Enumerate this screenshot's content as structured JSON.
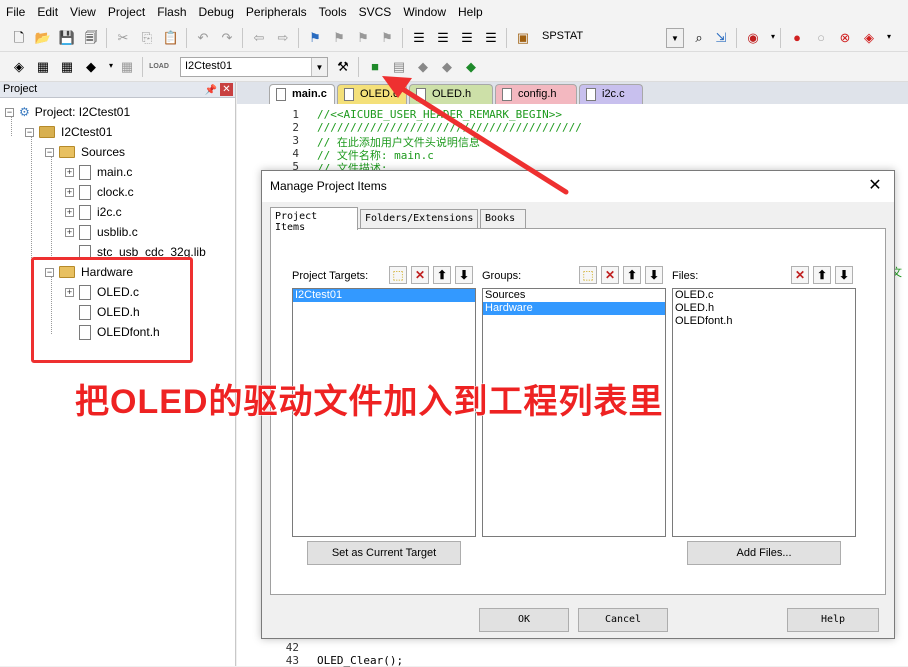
{
  "menu": [
    "File",
    "Edit",
    "View",
    "Project",
    "Flash",
    "Debug",
    "Peripherals",
    "Tools",
    "SVCS",
    "Window",
    "Help"
  ],
  "toolbar1": {
    "target_combo_value": "SPSTAT"
  },
  "toolbar2": {
    "load_label": "LOAD",
    "target_select_value": "I2Ctest01"
  },
  "project_panel": {
    "title": "Project",
    "tree": {
      "project": "Project: I2Ctest01",
      "target": "I2Ctest01",
      "groups": [
        {
          "name": "Sources",
          "files": [
            "main.c",
            "clock.c",
            "i2c.c",
            "usblib.c",
            "stc_usb_cdc_32g.lib"
          ]
        },
        {
          "name": "Hardware",
          "files": [
            "OLED.c",
            "OLED.h",
            "OLEDfont.h"
          ]
        }
      ]
    }
  },
  "editor": {
    "tabs": [
      "main.c",
      "OLED.c",
      "OLED.h",
      "config.h",
      "i2c.c"
    ],
    "lines": [
      {
        "n": "1",
        "text": "//<<AICUBE_USER_HEADER_REMARK_BEGIN>>"
      },
      {
        "n": "2",
        "text": "////////////////////////////////////////"
      },
      {
        "n": "3",
        "text": "// 在此添加用户文件头说明信息"
      },
      {
        "n": "4",
        "text": "// 文件名称: main.c"
      },
      {
        "n": "5",
        "text": "// 文件描述:"
      },
      {
        "n": "42",
        "text": ""
      },
      {
        "n": "43",
        "text": "  OLED_Clear();"
      }
    ],
    "right_edge_text": "头文"
  },
  "dialog": {
    "title": "Manage Project Items",
    "close_glyph": "✕",
    "tabs": [
      "Project Items",
      "Folders/Extensions",
      "Books"
    ],
    "targets": {
      "label": "Project Targets:",
      "items": [
        "I2Ctest01"
      ],
      "selected": 0
    },
    "groups": {
      "label": "Groups:",
      "items": [
        "Sources",
        "Hardware"
      ],
      "selected": 1
    },
    "files": {
      "label": "Files:",
      "items": [
        "OLED.c",
        "OLED.h",
        "OLEDfont.h"
      ]
    },
    "set_target_button": "Set as Current Target",
    "add_files_button": "Add Files...",
    "ok_button": "OK",
    "cancel_button": "Cancel",
    "help_button": "Help"
  },
  "annotation": {
    "text": "把OLED的驱动文件加入到工程列表里",
    "color": "#ee2222"
  }
}
